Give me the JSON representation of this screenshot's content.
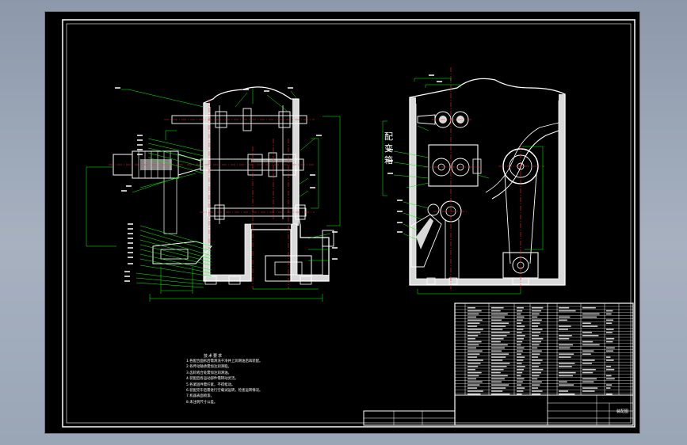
{
  "side_view": {
    "label_chars": [
      "配",
      "变",
      "箱"
    ]
  },
  "technical_requirements": {
    "title": "技术要求",
    "items": [
      "1.各配合面拆后需清洗干净并上润滑油后再装配。",
      "2.各传动轴承需加注润滑脂。",
      "3.齿轮啮合处需加注润滑油。",
      "4.装配后各运动部件需转动灵活。",
      "5.各紧固件需拧紧，不得松动。",
      "6.装配完毕后需进行空载试运转，检查运转情况。",
      "7.机器表面喷漆。",
      "8.未注明尺寸公差。"
    ]
  },
  "title_block": {
    "drawing_name": "装配图"
  },
  "colors": {
    "sheet": "#000000",
    "frame": "#ffffff",
    "geometry": "#ffffff",
    "leader": "#00ff00",
    "centerline": "#ff2a2a",
    "dimension": "#00ff00"
  }
}
